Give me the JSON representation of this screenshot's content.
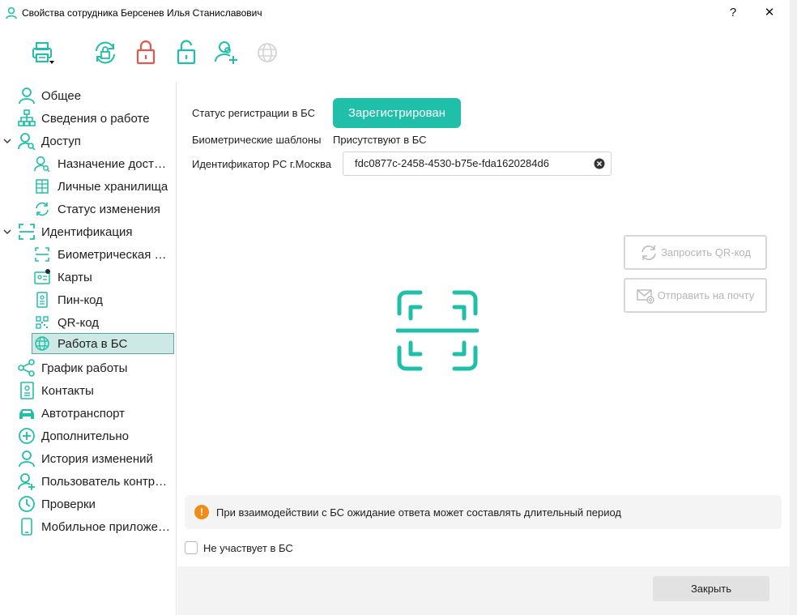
{
  "window": {
    "title": "Свойства сотрудника Берсенев Илья Станиславович",
    "help_label": "?",
    "close_label": "✕"
  },
  "toolbar": {
    "icons": [
      "printer-icon",
      "sync-lock-icon",
      "lock-icon",
      "unlock-icon",
      "user-add-icon",
      "globe-icon"
    ]
  },
  "sidebar": {
    "items": [
      {
        "label": "Общее",
        "icon": "user-icon"
      },
      {
        "label": "Сведения о работе",
        "icon": "org-chart-icon"
      },
      {
        "label": "Доступ",
        "icon": "user-access-icon"
      },
      {
        "label": "Назначение доступа",
        "icon": "user-access-icon"
      },
      {
        "label": "Личные хранилища",
        "icon": "storage-icon"
      },
      {
        "label": "Статус изменения",
        "icon": "refresh-icon"
      },
      {
        "label": "Идентификация",
        "icon": "scan-icon"
      },
      {
        "label": "Биометрическая идентификация",
        "icon": "scan-icon"
      },
      {
        "label": "Карты",
        "icon": "card-icon"
      },
      {
        "label": "Пин-код",
        "icon": "pin-icon"
      },
      {
        "label": "QR-код",
        "icon": "qr-icon"
      },
      {
        "label": "Работа в БС",
        "icon": "globe-icon"
      },
      {
        "label": "График работы",
        "icon": "share-icon"
      },
      {
        "label": "Контакты",
        "icon": "contacts-icon"
      },
      {
        "label": "Автотранспорт",
        "icon": "car-icon"
      },
      {
        "label": "Дополнительно",
        "icon": "plus-circle-icon"
      },
      {
        "label": "История изменений",
        "icon": "user-icon"
      },
      {
        "label": "Пользователь контроллера",
        "icon": "user-plus-icon"
      },
      {
        "label": "Проверки",
        "icon": "clock-icon"
      },
      {
        "label": "Мобильное приложение",
        "icon": "phone-icon"
      }
    ]
  },
  "main": {
    "status_label": "Статус регистрации в БС",
    "status_value": "Зарегистрирован",
    "biometric_label": "Биометрические шаблоны",
    "biometric_value": "Присутствуют в БС",
    "identifier_label": "Идентификатор РС г.Москва",
    "identifier_value": "fdc0877c-2458-4530-b75e-fda1620284d6",
    "request_qr_label": "Запросить QR-код",
    "send_mail_label": "Отправить на почту",
    "notice_text": "При взаимодействии с БС ожидание ответа может составлять длительный период",
    "not_participating_label": "Не участвует в БС",
    "close_button_label": "Закрыть"
  },
  "colors": {
    "accent": "#1fbfa9",
    "warning": "#f28c19",
    "danger": "#e4574a",
    "selected_bg": "#cde9e5"
  }
}
